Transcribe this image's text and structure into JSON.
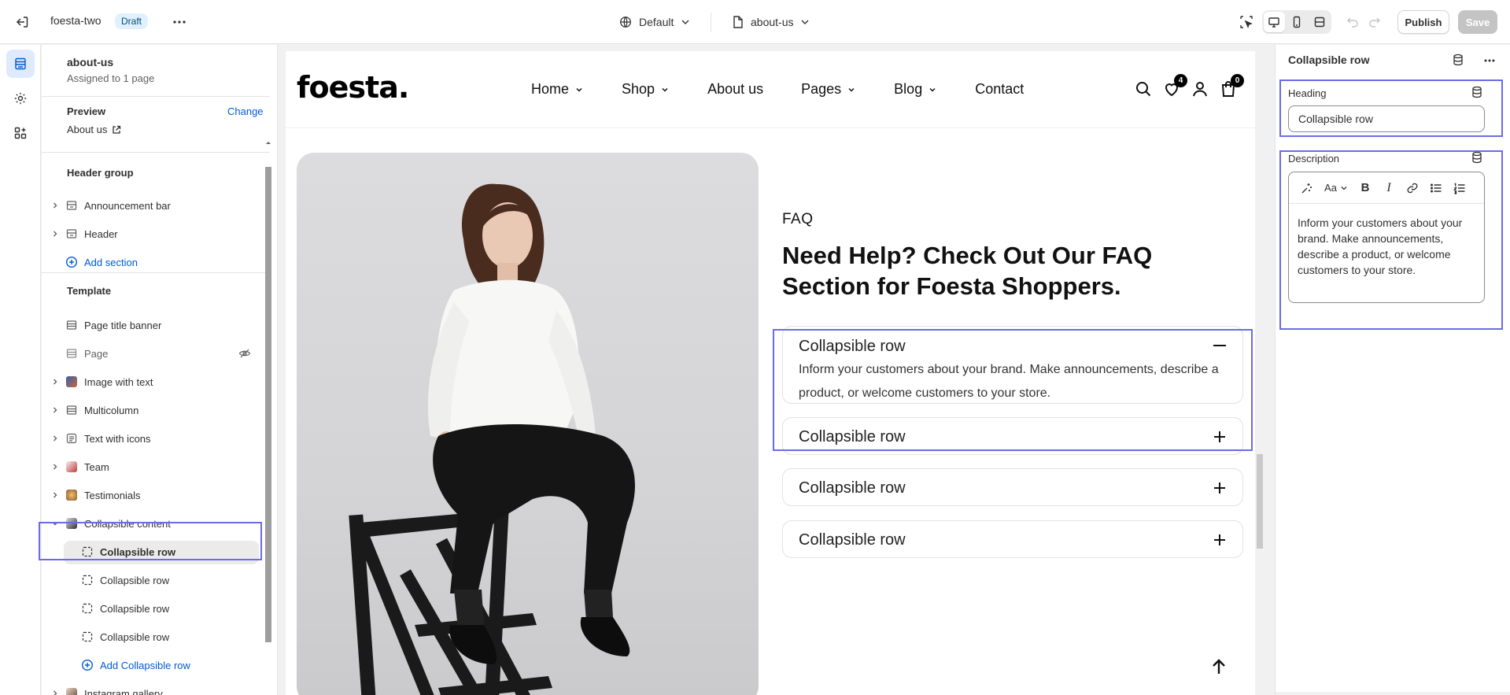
{
  "topbar": {
    "theme_name": "foesta-two",
    "status_badge": "Draft",
    "template_selector": "Default",
    "page_selector": "about-us",
    "publish_label": "Publish",
    "save_label": "Save"
  },
  "sidebar": {
    "title": "about-us",
    "subtitle": "Assigned to 1 page",
    "preview_label": "Preview",
    "change_label": "Change",
    "preview_page": "About us",
    "header_group_label": "Header group",
    "header_items": [
      {
        "label": "Announcement bar",
        "icon": "section-icon"
      },
      {
        "label": "Header",
        "icon": "section-icon"
      }
    ],
    "add_section_label": "Add section",
    "template_label": "Template",
    "template_items": [
      {
        "label": "Page title banner",
        "icon": "section-icon"
      },
      {
        "label": "Page",
        "icon": "section-icon"
      },
      {
        "label": "Image with text",
        "icon": "image-thumb"
      },
      {
        "label": "Multicolumn",
        "icon": "section-icon"
      },
      {
        "label": "Text with icons",
        "icon": "text-icon"
      },
      {
        "label": "Team",
        "icon": "image-thumb"
      },
      {
        "label": "Testimonials",
        "icon": "image-thumb"
      },
      {
        "label": "Collapsible content",
        "icon": "image-thumb"
      }
    ],
    "block_items": [
      {
        "label": "Collapsible row"
      },
      {
        "label": "Collapsible row"
      },
      {
        "label": "Collapsible row"
      },
      {
        "label": "Collapsible row"
      }
    ],
    "add_block_label": "Add Collapsible row",
    "after_items": [
      {
        "label": "Instagram gallery",
        "icon": "image-thumb"
      }
    ]
  },
  "store": {
    "logo": "foesta.",
    "nav": [
      "Home",
      "Shop",
      "About us",
      "Pages",
      "Blog",
      "Contact"
    ],
    "nav_dropdown": [
      true,
      true,
      false,
      true,
      true,
      false
    ],
    "wishlist_count": "4",
    "cart_count": "0",
    "faq_label": "FAQ",
    "faq_title": "Need Help? Check Out Our FAQ Section for Foesta Shoppers.",
    "rows": [
      {
        "title": "Collapsible row",
        "open": true,
        "desc": "Inform your customers about your brand. Make announcements, describe a product, or welcome customers to your store."
      },
      {
        "title": "Collapsible row",
        "open": false
      },
      {
        "title": "Collapsible row",
        "open": false
      },
      {
        "title": "Collapsible row",
        "open": false
      }
    ]
  },
  "settings": {
    "title": "Collapsible row",
    "heading_label": "Heading",
    "heading_value": "Collapsible row",
    "description_label": "Description",
    "description_text": "Inform your customers about your brand. Make announcements, describe a product, or welcome customers to your store."
  },
  "colors": {
    "accent": "#005bd3",
    "highlight": "#6b6be8",
    "badge_bg": "#e0f0ff"
  }
}
